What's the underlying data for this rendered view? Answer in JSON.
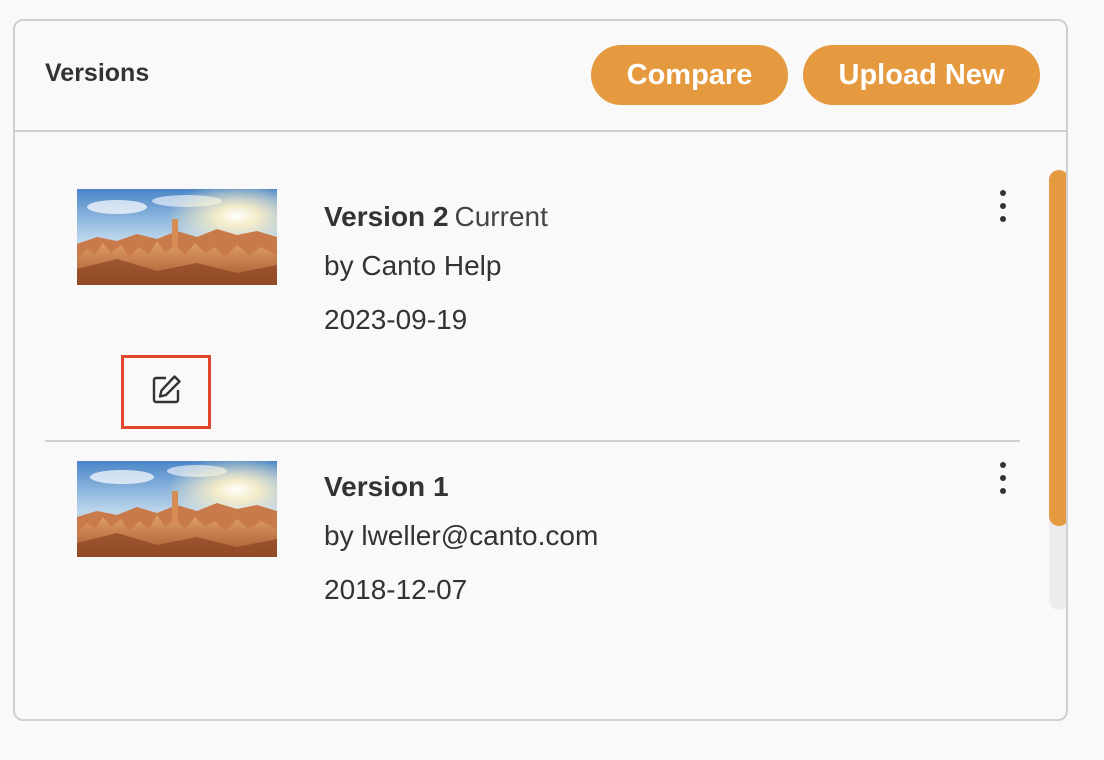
{
  "panel": {
    "title": "Versions",
    "compare_label": "Compare",
    "upload_label": "Upload New"
  },
  "versions": [
    {
      "title": "Version 2",
      "tag": "Current",
      "author": "by Canto Help",
      "date": "2023-09-19",
      "thumbnail_icon": "canyon-landscape-thumbnail",
      "has_edit": true
    },
    {
      "title": "Version 1",
      "tag": "",
      "author": "by lweller@canto.com",
      "date": "2018-12-07",
      "thumbnail_icon": "canyon-landscape-thumbnail",
      "has_edit": false
    }
  ],
  "scrollbar": {
    "thumb_fraction": 0.81
  },
  "colors": {
    "accent": "#e69a40",
    "highlight": "#e2472e",
    "border": "#cfcfcf",
    "text": "#333333"
  }
}
